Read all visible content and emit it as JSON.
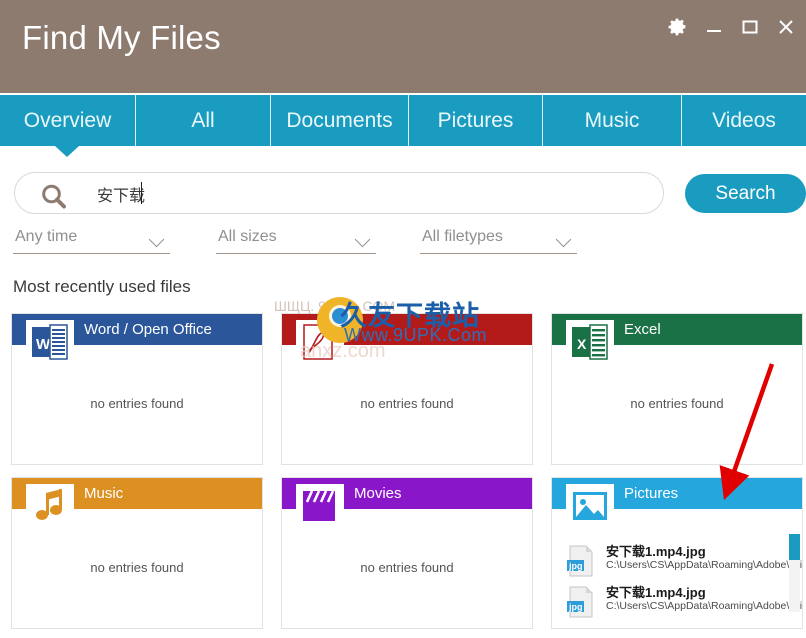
{
  "window": {
    "title": "Find My Files",
    "controls": [
      {
        "name": "settings-gear",
        "label": "Settings"
      },
      {
        "name": "minimize",
        "label": "Minimize"
      },
      {
        "name": "maximize",
        "label": "Maximize"
      },
      {
        "name": "close",
        "label": "Close"
      }
    ]
  },
  "tabs": [
    {
      "label": "Overview",
      "active": true
    },
    {
      "label": "All",
      "active": false
    },
    {
      "label": "Documents",
      "active": false
    },
    {
      "label": "Pictures",
      "active": false
    },
    {
      "label": "Music",
      "active": false
    },
    {
      "label": "Videos",
      "active": false
    }
  ],
  "search": {
    "value": "安下载",
    "placeholder": "",
    "button_label": "Search",
    "icon": "search-icon"
  },
  "filters": [
    {
      "name": "time-filter",
      "value": "Any time"
    },
    {
      "name": "size-filter",
      "value": "All sizes"
    },
    {
      "name": "filetype-filter",
      "value": "All filetypes"
    }
  ],
  "section": {
    "title": "Most recently used files",
    "empty_text": "no entries found"
  },
  "cards": [
    {
      "id": "word",
      "title": "Word / Open Office",
      "color": "#2b579a",
      "icon": "word-icon",
      "empty": true,
      "files": []
    },
    {
      "id": "pdf",
      "title": "",
      "color": "#b31b1b",
      "icon": "pdf-icon",
      "empty": true,
      "files": []
    },
    {
      "id": "excel",
      "title": "Excel",
      "color": "#1a7145",
      "icon": "excel-icon",
      "empty": true,
      "files": []
    },
    {
      "id": "music",
      "title": "Music",
      "color": "#dd9022",
      "icon": "music-note-icon",
      "empty": true,
      "files": []
    },
    {
      "id": "movies",
      "title": "Movies",
      "color": "#8a16c9",
      "icon": "clapperboard-icon",
      "empty": true,
      "files": []
    },
    {
      "id": "pictures",
      "title": "Pictures",
      "color": "#25a6dd",
      "icon": "picture-icon",
      "empty": false,
      "files": [
        {
          "name": "安下载1.mp4.jpg",
          "path": "C:\\Users\\CS\\AppData\\Roaming\\Adobe\\Bri...",
          "type_badge": "jpg"
        },
        {
          "name": "安下载1.mp4.jpg",
          "path": "C:\\Users\\CS\\AppData\\Roaming\\Adobe\\Bri...",
          "type_badge": "jpg"
        }
      ]
    }
  ],
  "watermark": {
    "brand": "久友下载站",
    "url": "Www.9UPK.Com",
    "ghost_left": "ШЩЦ. 9UPK. COM",
    "ghost_bottom": "anxz.com"
  },
  "annotation": {
    "type": "arrow",
    "color": "#e00000",
    "points_to": "pictures-card-header"
  },
  "colors": {
    "titlebar": "#8d7b6f",
    "accent": "#1a9cc0",
    "tab_text": "#eaf7fb",
    "annotation_red": "#e00000"
  }
}
